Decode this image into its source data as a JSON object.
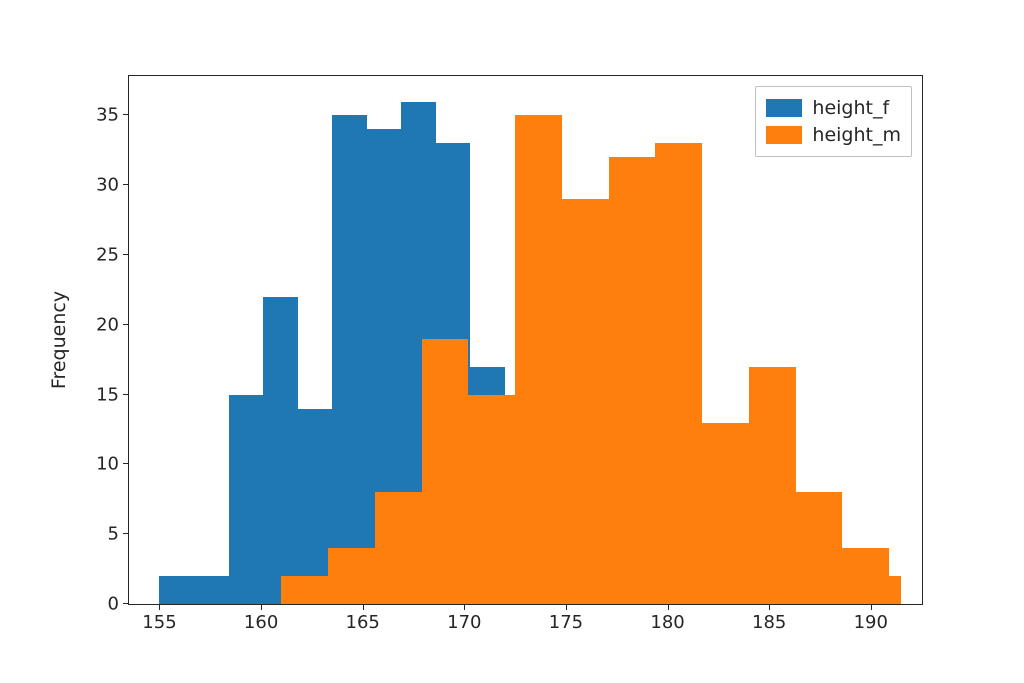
{
  "chart_data": {
    "type": "bar",
    "title": "",
    "xlabel": "",
    "ylabel": "Frequency",
    "xlim": [
      153.5,
      192.5
    ],
    "ylim": [
      0,
      37.8
    ],
    "xticks": [
      155,
      160,
      165,
      170,
      175,
      180,
      185,
      190
    ],
    "yticks": [
      0,
      5,
      10,
      15,
      20,
      25,
      30,
      35
    ],
    "legend_position": "upper right",
    "series": [
      {
        "name": "height_f",
        "color": "#1f77b4",
        "bin_edges": [
          155,
          156.7,
          158.4,
          160.1,
          161.8,
          163.5,
          165.2,
          166.9,
          168.6,
          170.3,
          172
        ],
        "values": [
          2,
          2,
          15,
          22,
          14,
          35,
          34,
          36,
          33,
          17
        ]
      },
      {
        "name": "height_m",
        "color": "#ff7f0e",
        "bin_edges": [
          161,
          164,
          167,
          170,
          173,
          176,
          179,
          182,
          185,
          188,
          191
        ],
        "values": [
          2,
          4,
          8,
          19,
          35,
          29,
          32,
          33,
          13,
          17,
          8,
          4,
          2
        ],
        "_note_full_edges": [
          161,
          163.5,
          166,
          168.5,
          171,
          173.5,
          176,
          178.5,
          181,
          183.5,
          186,
          188.5,
          191.0,
          193.5
        ],
        "_render_edges": [
          161,
          163.5,
          166,
          168.5,
          171,
          173.5,
          176,
          178.5,
          181,
          183.5,
          186,
          188.5,
          191.0,
          193.5
        ]
      }
    ],
    "series_render": [
      {
        "name": "height_f",
        "color": "#1f77b4",
        "bars": [
          {
            "x0": 155.0,
            "x1": 156.7,
            "y": 2
          },
          {
            "x0": 156.7,
            "x1": 158.4,
            "y": 2
          },
          {
            "x0": 158.4,
            "x1": 160.1,
            "y": 15
          },
          {
            "x0": 160.1,
            "x1": 161.8,
            "y": 22
          },
          {
            "x0": 161.8,
            "x1": 163.5,
            "y": 14
          },
          {
            "x0": 163.5,
            "x1": 165.2,
            "y": 35
          },
          {
            "x0": 165.2,
            "x1": 166.9,
            "y": 34
          },
          {
            "x0": 166.9,
            "x1": 168.6,
            "y": 36
          },
          {
            "x0": 168.6,
            "x1": 170.3,
            "y": 33
          },
          {
            "x0": 170.3,
            "x1": 172.0,
            "y": 17
          }
        ]
      },
      {
        "name": "height_m",
        "color": "#ff7f0e",
        "bars": [
          {
            "x0": 161.0,
            "x1": 163.3,
            "y": 2
          },
          {
            "x0": 163.3,
            "x1": 165.6,
            "y": 4
          },
          {
            "x0": 165.6,
            "x1": 167.9,
            "y": 8
          },
          {
            "x0": 167.9,
            "x1": 170.2,
            "y": 19
          },
          {
            "x0": 170.2,
            "x1": 172.5,
            "y": 15
          },
          {
            "x0": 172.5,
            "x1": 174.8,
            "y": 35
          },
          {
            "x0": 174.8,
            "x1": 177.1,
            "y": 29
          },
          {
            "x0": 177.1,
            "x1": 179.4,
            "y": 32
          },
          {
            "x0": 179.4,
            "x1": 181.7,
            "y": 33
          },
          {
            "x0": 181.7,
            "x1": 184.0,
            "y": 13
          },
          {
            "x0": 184.0,
            "x1": 186.3,
            "y": 17
          },
          {
            "x0": 186.3,
            "x1": 188.6,
            "y": 8
          },
          {
            "x0": 188.6,
            "x1": 190.9,
            "y": 4
          },
          {
            "x0": 190.9,
            "x1": 191.5,
            "y": 2
          }
        ]
      }
    ],
    "legend": [
      "height_f",
      "height_m"
    ]
  }
}
